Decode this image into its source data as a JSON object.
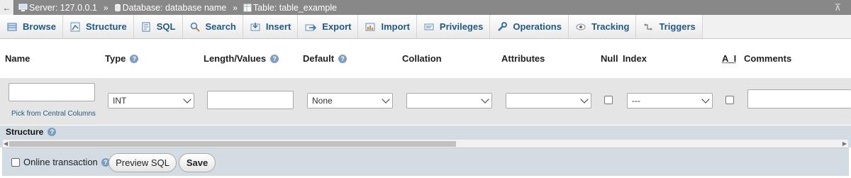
{
  "breadcrumb": {
    "server": "Server: 127.0.0.1",
    "database": "Database: database name",
    "table": "Table: table_example",
    "separator": "»"
  },
  "tabs": [
    {
      "label": "Browse",
      "icon": "browse-icon"
    },
    {
      "label": "Structure",
      "icon": "structure-icon"
    },
    {
      "label": "SQL",
      "icon": "sql-icon"
    },
    {
      "label": "Search",
      "icon": "search-icon"
    },
    {
      "label": "Insert",
      "icon": "insert-icon"
    },
    {
      "label": "Export",
      "icon": "export-icon"
    },
    {
      "label": "Import",
      "icon": "import-icon"
    },
    {
      "label": "Privileges",
      "icon": "privileges-icon"
    },
    {
      "label": "Operations",
      "icon": "operations-icon"
    },
    {
      "label": "Tracking",
      "icon": "tracking-icon"
    },
    {
      "label": "Triggers",
      "icon": "triggers-icon"
    }
  ],
  "columns": {
    "name": "Name",
    "type": "Type",
    "length": "Length/Values",
    "default": "Default",
    "collation": "Collation",
    "attributes": "Attributes",
    "null": "Null",
    "index": "Index",
    "ai": "A_I",
    "comments": "Comments"
  },
  "row": {
    "name_value": "",
    "pick_link": "Pick from Central Columns",
    "type_value": "INT",
    "length_value": "",
    "default_value": "None",
    "collation_value": "",
    "attributes_value": "",
    "null_checked": false,
    "index_value": "---",
    "ai_checked": false,
    "comments_value": ""
  },
  "structure_label": "Structure",
  "footer": {
    "online_transaction_label": "Online transaction",
    "online_transaction_checked": false,
    "preview_sql_label": "Preview SQL",
    "save_label": "Save"
  },
  "colors": {
    "tab_text": "#235a81",
    "band": "#d3dce3",
    "topbar": "#888888"
  }
}
